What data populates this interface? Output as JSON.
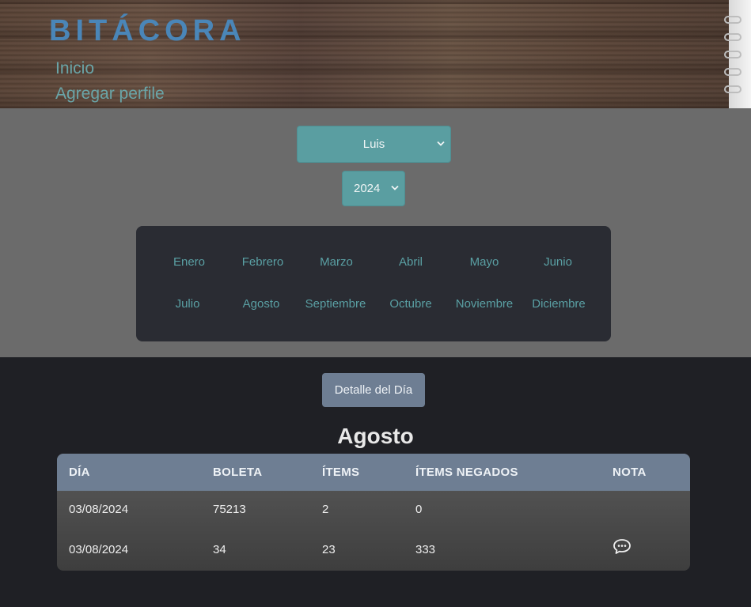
{
  "header": {
    "brand": "BITÁCORA",
    "nav": [
      {
        "label": "Inicio"
      },
      {
        "label": "Agregar perfile"
      }
    ]
  },
  "filters": {
    "person_selected": "Luis",
    "year_selected": "2024"
  },
  "months": [
    "Enero",
    "Febrero",
    "Marzo",
    "Abril",
    "Mayo",
    "Junio",
    "Julio",
    "Agosto",
    "Septiembre",
    "Octubre",
    "Noviembre",
    "Diciembre"
  ],
  "detail_button": "Detalle del Día",
  "month_title": "Agosto",
  "table": {
    "headers": [
      "DÍA",
      "BOLETA",
      "ÍTEMS",
      "ÍTEMS NEGADOS",
      "NOTA"
    ],
    "rows": [
      {
        "dia": "03/08/2024",
        "boleta": "75213",
        "items": "2",
        "negados": "0"
      },
      {
        "dia": "03/08/2024",
        "boleta": "34",
        "items": "23",
        "negados": "333"
      }
    ]
  },
  "icons": {
    "note": "chat-bubble-icon"
  },
  "colors": {
    "brand": "#4a86b8",
    "accent": "#5a9ea1",
    "link": "#6aa5a8",
    "table_header": "#6e7e93"
  }
}
